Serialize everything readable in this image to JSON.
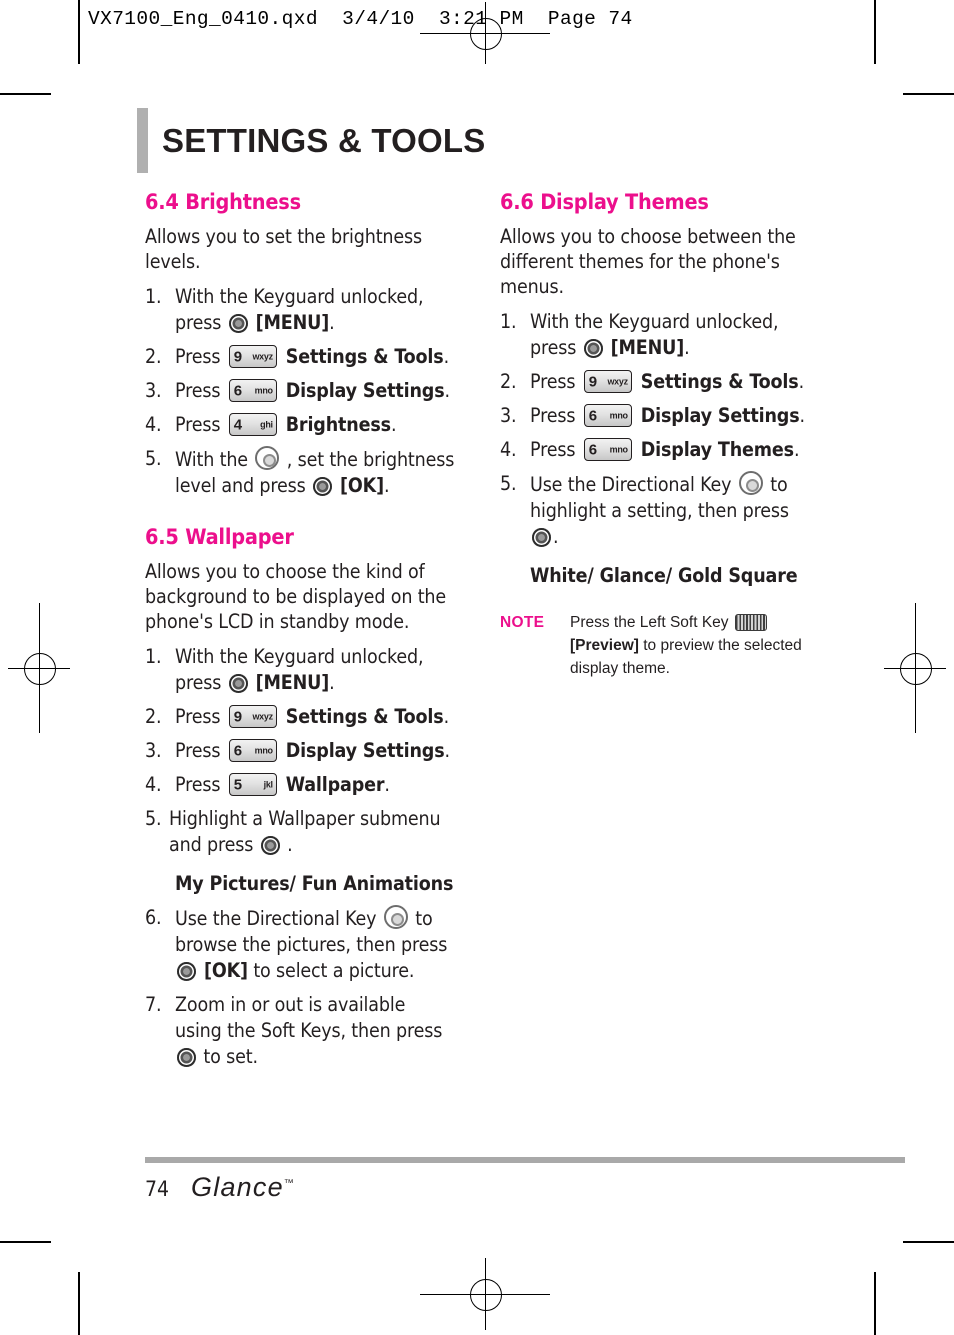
{
  "print_marks": {
    "file_strip": "VX7100_Eng_0410.qxd  3/4/10  3:21 PM  Page 74"
  },
  "header": {
    "title": "SETTINGS & TOOLS"
  },
  "colors": {
    "accent_pink": "#ec0f8c",
    "body_text": "#231f20",
    "rule_gray": "#a9a9a9"
  },
  "icons": {
    "ok_key": "ok-round-key-icon",
    "directional_key": "directional-key-icon",
    "left_soft_key": "left-soft-key-icon"
  },
  "left_column": {
    "sections": [
      {
        "heading": "6.4 Brightness",
        "intro": "Allows you to set the brightness levels.",
        "steps": [
          {
            "num": "1.",
            "parts": [
              {
                "t": "text",
                "v": "With the Keyguard unlocked, press "
              },
              {
                "t": "icon",
                "v": "ok"
              },
              {
                "t": "bold",
                "v": " [MENU]"
              },
              {
                "t": "text",
                "v": "."
              }
            ]
          },
          {
            "num": "2.",
            "parts": [
              {
                "t": "text",
                "v": "Press "
              },
              {
                "t": "key",
                "digit": "9",
                "letters": "wxyz"
              },
              {
                "t": "bold",
                "v": " Settings & Tools"
              },
              {
                "t": "text",
                "v": "."
              }
            ]
          },
          {
            "num": "3.",
            "parts": [
              {
                "t": "text",
                "v": "Press "
              },
              {
                "t": "key",
                "digit": "6",
                "letters": "mno"
              },
              {
                "t": "bold",
                "v": " Display Settings"
              },
              {
                "t": "text",
                "v": "."
              }
            ]
          },
          {
            "num": "4.",
            "parts": [
              {
                "t": "text",
                "v": "Press "
              },
              {
                "t": "key",
                "digit": "4",
                "letters": "ghi"
              },
              {
                "t": "bold",
                "v": " Brightness"
              },
              {
                "t": "text",
                "v": "."
              }
            ]
          },
          {
            "num": "5.",
            "parts": [
              {
                "t": "text",
                "v": "With the "
              },
              {
                "t": "icon",
                "v": "dir"
              },
              {
                "t": "text",
                "v": " , set the brightness level and press "
              },
              {
                "t": "icon",
                "v": "ok"
              },
              {
                "t": "bold",
                "v": " [OK]"
              },
              {
                "t": "text",
                "v": "."
              }
            ]
          }
        ]
      },
      {
        "heading": "6.5 Wallpaper",
        "intro": "Allows you to choose the kind of background to be displayed on the phone's LCD in standby mode.",
        "steps": [
          {
            "num": "1.",
            "parts": [
              {
                "t": "text",
                "v": "With the Keyguard unlocked, press "
              },
              {
                "t": "icon",
                "v": "ok"
              },
              {
                "t": "bold",
                "v": " [MENU]"
              },
              {
                "t": "text",
                "v": "."
              }
            ]
          },
          {
            "num": "2.",
            "parts": [
              {
                "t": "text",
                "v": "Press "
              },
              {
                "t": "key",
                "digit": "9",
                "letters": "wxyz"
              },
              {
                "t": "bold",
                "v": " Settings & Tools"
              },
              {
                "t": "text",
                "v": "."
              }
            ]
          },
          {
            "num": "3.",
            "parts": [
              {
                "t": "text",
                "v": "Press "
              },
              {
                "t": "key",
                "digit": "6",
                "letters": "mno"
              },
              {
                "t": "bold",
                "v": "  Display Settings"
              },
              {
                "t": "text",
                "v": "."
              }
            ]
          },
          {
            "num": "4.",
            "parts": [
              {
                "t": "text",
                "v": "Press "
              },
              {
                "t": "key",
                "digit": "5",
                "letters": "jkl"
              },
              {
                "t": "bold",
                "v": " Wallpaper"
              },
              {
                "t": "text",
                "v": "."
              }
            ]
          },
          {
            "num": "5.",
            "tight": true,
            "parts": [
              {
                "t": "text",
                "v": "Highlight a Wallpaper submenu and press "
              },
              {
                "t": "icon",
                "v": "ok"
              },
              {
                "t": "text",
                "v": " ."
              }
            ]
          }
        ],
        "subhead": "My Pictures/ Fun Animations",
        "steps_after": [
          {
            "num": "6.",
            "parts": [
              {
                "t": "text",
                "v": "Use the Directional Key "
              },
              {
                "t": "icon",
                "v": "dir"
              },
              {
                "t": "text",
                "v": " to browse the pictures, then press "
              },
              {
                "t": "icon",
                "v": "ok"
              },
              {
                "t": "bold",
                "v": " [OK]"
              },
              {
                "t": "text",
                "v": " to select a picture."
              }
            ]
          },
          {
            "num": "7.",
            "parts": [
              {
                "t": "text",
                "v": "Zoom in or out is available using the Soft Keys, then press "
              },
              {
                "t": "icon",
                "v": "ok"
              },
              {
                "t": "text",
                "v": " to set."
              }
            ]
          }
        ]
      }
    ]
  },
  "right_column": {
    "sections": [
      {
        "heading": "6.6 Display Themes",
        "intro": "Allows you to choose between the different themes for the phone's menus.",
        "steps": [
          {
            "num": "1.",
            "parts": [
              {
                "t": "text",
                "v": "With the Keyguard unlocked, press "
              },
              {
                "t": "icon",
                "v": "ok"
              },
              {
                "t": "bold",
                "v": " [MENU]"
              },
              {
                "t": "text",
                "v": "."
              }
            ]
          },
          {
            "num": "2.",
            "parts": [
              {
                "t": "text",
                "v": "Press "
              },
              {
                "t": "key",
                "digit": "9",
                "letters": "wxyz"
              },
              {
                "t": "bold",
                "v": " Settings & Tools"
              },
              {
                "t": "text",
                "v": "."
              }
            ]
          },
          {
            "num": "3.",
            "parts": [
              {
                "t": "text",
                "v": "Press "
              },
              {
                "t": "key",
                "digit": "6",
                "letters": "mno"
              },
              {
                "t": "bold",
                "v": " Display Settings"
              },
              {
                "t": "text",
                "v": "."
              }
            ]
          },
          {
            "num": "4.",
            "parts": [
              {
                "t": "text",
                "v": "Press "
              },
              {
                "t": "key",
                "digit": "6",
                "letters": "mno"
              },
              {
                "t": "bold",
                "v": " Display Themes"
              },
              {
                "t": "text",
                "v": "."
              }
            ]
          },
          {
            "num": "5.",
            "parts": [
              {
                "t": "text",
                "v": "Use the Directional Key "
              },
              {
                "t": "icon",
                "v": "dir"
              },
              {
                "t": "text",
                "v": " to highlight a setting, then press "
              },
              {
                "t": "icon",
                "v": "ok"
              },
              {
                "t": "text",
                "v": "."
              }
            ]
          }
        ],
        "subhead": "White/ Glance/ Gold Square",
        "note": {
          "label": "NOTE",
          "parts": [
            {
              "t": "text",
              "v": "Press the Left Soft Key "
            },
            {
              "t": "icon",
              "v": "soft"
            },
            {
              "t": "bold",
              "v": " [Preview]"
            },
            {
              "t": "text",
              "v": " to preview the selected display theme."
            }
          ]
        }
      }
    ]
  },
  "footer": {
    "page_number": "74",
    "brand": "Glance",
    "trademark": "™"
  }
}
